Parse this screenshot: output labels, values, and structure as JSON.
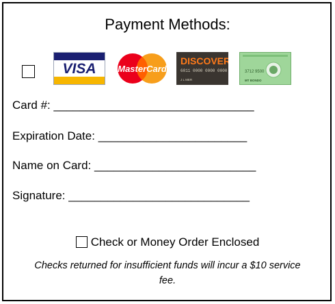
{
  "title": "Payment Methods:",
  "cards": [
    {
      "icon": "visa-card-icon",
      "text": "VISA"
    },
    {
      "icon": "mastercard-card-icon",
      "text": "MasterCard"
    },
    {
      "icon": "discover-card-icon",
      "text": "DISCOVER",
      "number": "6011 0000 0000 0000",
      "holder": "J L MER"
    },
    {
      "icon": "amex-card-icon",
      "number": "3712 9500",
      "holder": "MT BONDO"
    }
  ],
  "fields": [
    {
      "label": "Card #:",
      "line": "_______________________________"
    },
    {
      "label": "Expiration Date:",
      "line": "_______________________"
    },
    {
      "label": "Name on Card:",
      "line": "_________________________"
    },
    {
      "label": "Signature:",
      "line": "____________________________"
    }
  ],
  "check_option": "Check or Money Order Enclosed",
  "note": "Checks returned for insufficient funds will incur a $10 service fee."
}
